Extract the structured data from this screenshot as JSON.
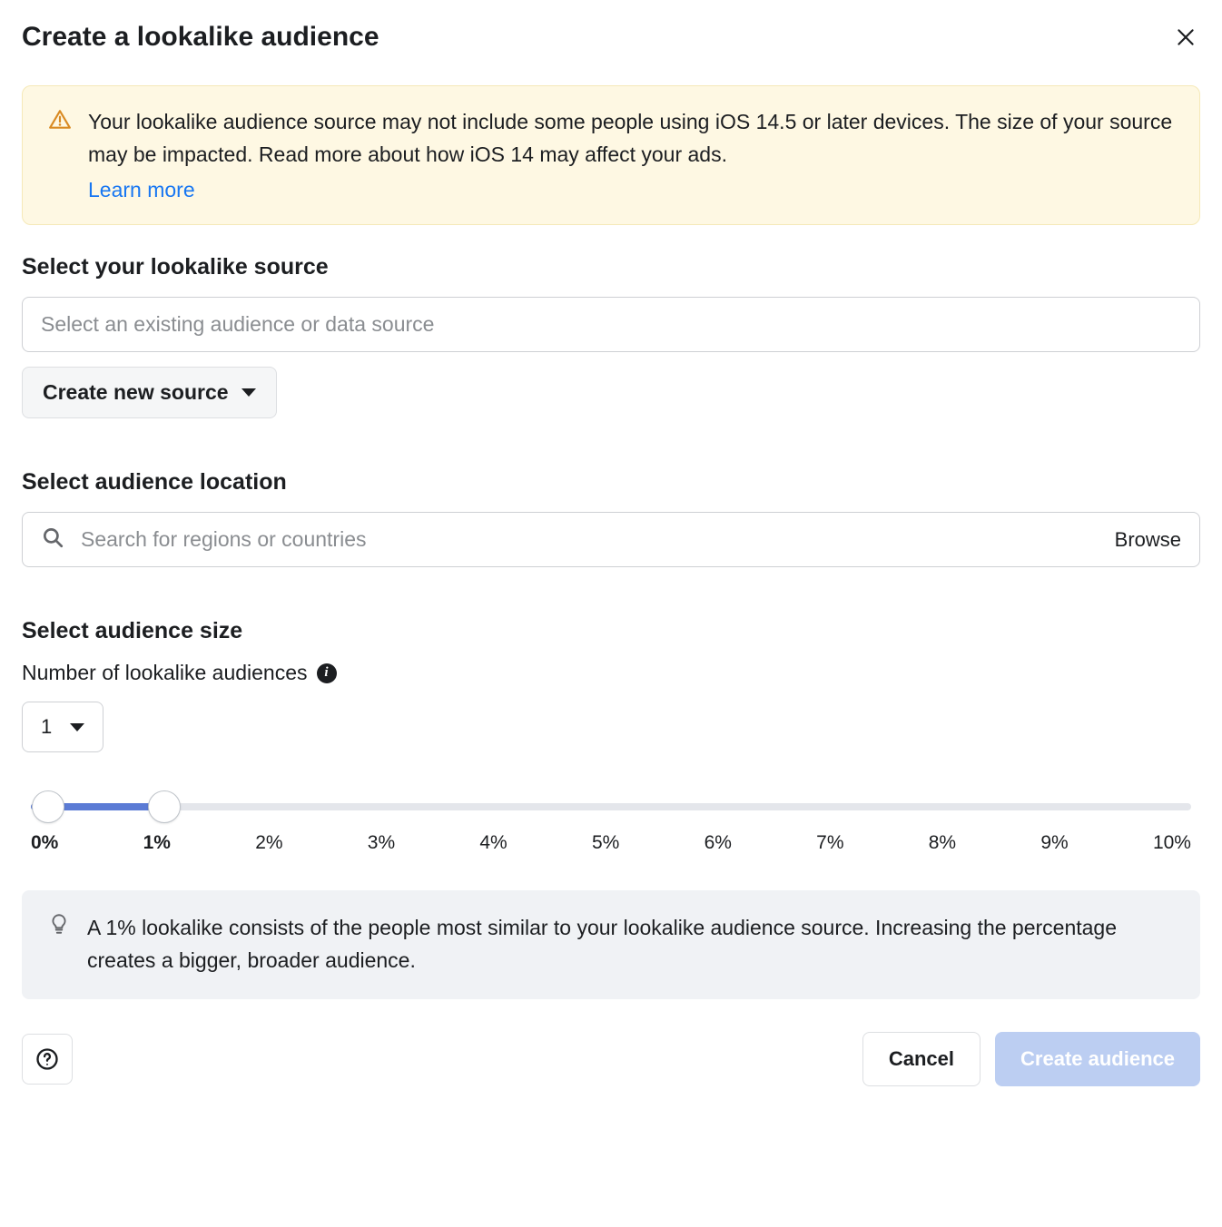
{
  "header": {
    "title": "Create a lookalike audience"
  },
  "warning": {
    "text": "Your lookalike audience source may not include some people using iOS 14.5 or later devices. The size of your source may be impacted. Read more about how iOS 14 may affect your ads.",
    "learn_more": "Learn more"
  },
  "source": {
    "title": "Select your lookalike source",
    "placeholder": "Select an existing audience or data source",
    "create_new_label": "Create new source"
  },
  "location": {
    "title": "Select audience location",
    "placeholder": "Search for regions or countries",
    "browse_label": "Browse"
  },
  "size": {
    "title": "Select audience size",
    "sub_label": "Number of lookalike audiences",
    "count_value": "1",
    "slider": {
      "start_pct": 0,
      "end_pct": 1,
      "ticks": [
        "0%",
        "1%",
        "2%",
        "3%",
        "4%",
        "5%",
        "6%",
        "7%",
        "8%",
        "9%",
        "10%"
      ]
    },
    "tip": "A 1% lookalike consists of the people most similar to your lookalike audience source. Increasing the percentage creates a bigger, broader audience."
  },
  "footer": {
    "cancel_label": "Cancel",
    "create_label": "Create audience"
  }
}
